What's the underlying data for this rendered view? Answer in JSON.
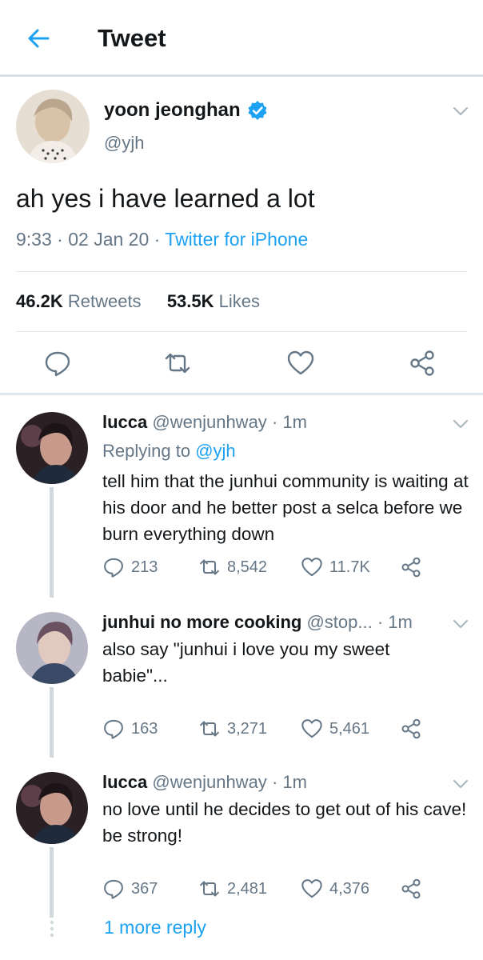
{
  "header": {
    "title": "Tweet",
    "back_icon": "arrow-left-icon",
    "accent": "#1da1f2"
  },
  "tweet": {
    "display_name": "yoon jeonghan",
    "handle": "@yjh",
    "verified_icon": "verified-badge-icon",
    "text": "ah yes i have learned a lot",
    "time": "9:33",
    "date": "02 Jan 20",
    "separator": "·",
    "source": "Twitter for iPhone",
    "retweets_count": "46.2K",
    "retweets_label": "Retweets",
    "likes_count": "53.5K",
    "likes_label": "Likes",
    "actions": [
      "reply-icon",
      "retweet-icon",
      "like-icon",
      "share-icon"
    ]
  },
  "replies": [
    {
      "display_name": "lucca",
      "handle": "@wenjunhway",
      "time": "· 1m",
      "replying_label": "Replying to",
      "replying_to": "@yjh",
      "text": "tell him that the junhui community is waiting at his door and he better post  a selca before we burn everything down",
      "reply_count": "213",
      "retweet_count": "8,542",
      "like_count": "11.7K"
    },
    {
      "display_name": "junhui no more cooking",
      "handle": "@stop...",
      "time": "· 1m",
      "text": "also say \"junhui i love you my sweet babie\"...",
      "reply_count": "163",
      "retweet_count": "3,271",
      "like_count": "5,461"
    },
    {
      "display_name": "lucca",
      "handle": "@wenjunhway",
      "time": "· 1m",
      "text": "no love until he decides to get out of his cave! be strong!",
      "reply_count": "367",
      "retweet_count": "2,481",
      "like_count": "4,376"
    }
  ],
  "more_replies": "1 more reply"
}
